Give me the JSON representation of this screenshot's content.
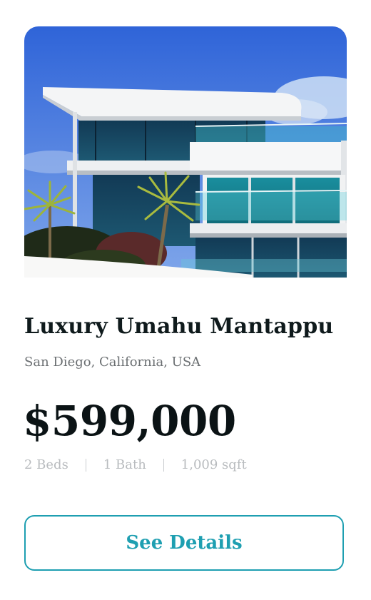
{
  "listing": {
    "title": "Luxury Umahu Mantappu",
    "location": "San Diego, California, USA",
    "price": "$599,000",
    "specs": {
      "beds": "2 Beds",
      "baths": "1 Bath",
      "area": "1,009 sqft"
    },
    "cta_label": "See Details",
    "image_icon": "house-photo"
  },
  "colors": {
    "accent": "#1e9fb1",
    "title": "#0f1a1c",
    "muted": "#6b6f72",
    "specs": "#b9bcbf"
  }
}
